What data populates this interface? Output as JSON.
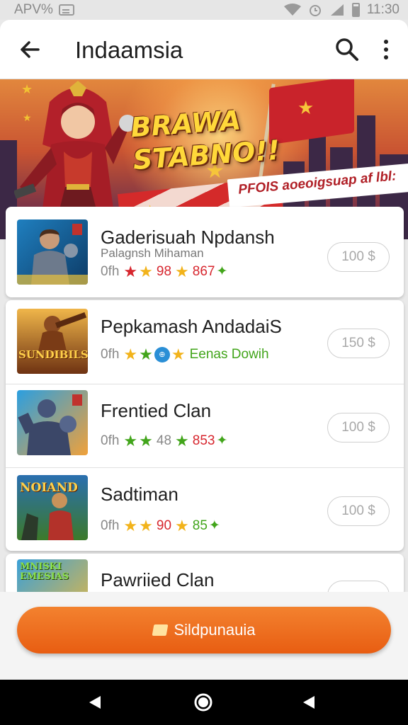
{
  "status_bar": {
    "carrier": "APV%",
    "time": "11:30"
  },
  "header": {
    "title": "Indaamsia"
  },
  "banner": {
    "headline_line1": "BRAWA",
    "headline_line2": "STABNO!!",
    "ribbon": "PFOIS aoeoigsuap af lbl:"
  },
  "list": [
    {
      "title": "Gaderisuah Npdansh",
      "subtitle": "Palagnsh Mihaman",
      "rating_prefix": "0fh",
      "stars": [
        "#d7262e",
        "#f2b31b"
      ],
      "rating_text": "98",
      "trailing_star": "#f2b31b",
      "score": "867",
      "score_color": "#d7262e",
      "price": "100 $"
    },
    {
      "title": "Pepkamash AndadaiS",
      "subtitle": "",
      "rating_prefix": "0fh",
      "stars": [
        "#f2b31b",
        "#42a51b"
      ],
      "rating_text": "Eenas Dowih",
      "trailing_star": "#f2b31b",
      "score": "",
      "score_color": "#42a51b",
      "price": "150 $"
    },
    {
      "title": "Frentied Clan",
      "subtitle": "",
      "rating_prefix": "0fh",
      "stars": [
        "#42a51b",
        "#42a51b"
      ],
      "rating_text": "48",
      "trailing_star": "#42a51b",
      "score": "853",
      "score_color": "#d7262e",
      "price": "100 $"
    },
    {
      "title": "Sadtiman",
      "subtitle": "",
      "rating_prefix": "0fh",
      "stars": [
        "#f2b31b",
        "#f2b31b"
      ],
      "rating_text": "90",
      "trailing_star": "#f2b31b",
      "score": "85",
      "score_color": "#42a51b",
      "price": "100 $"
    },
    {
      "title": "Pawriied Clan",
      "subtitle": "",
      "rating_prefix": "",
      "stars": [],
      "rating_text": "",
      "trailing_star": "",
      "score": "",
      "score_color": "",
      "price": ""
    }
  ],
  "thumb_text": [
    "",
    "SUNDIBILS",
    "",
    "NOIAND",
    "MNISKI EMESIAS"
  ],
  "cta": {
    "label": "Sildpunauia"
  },
  "colors": {
    "accent": "#ee6d1f"
  }
}
